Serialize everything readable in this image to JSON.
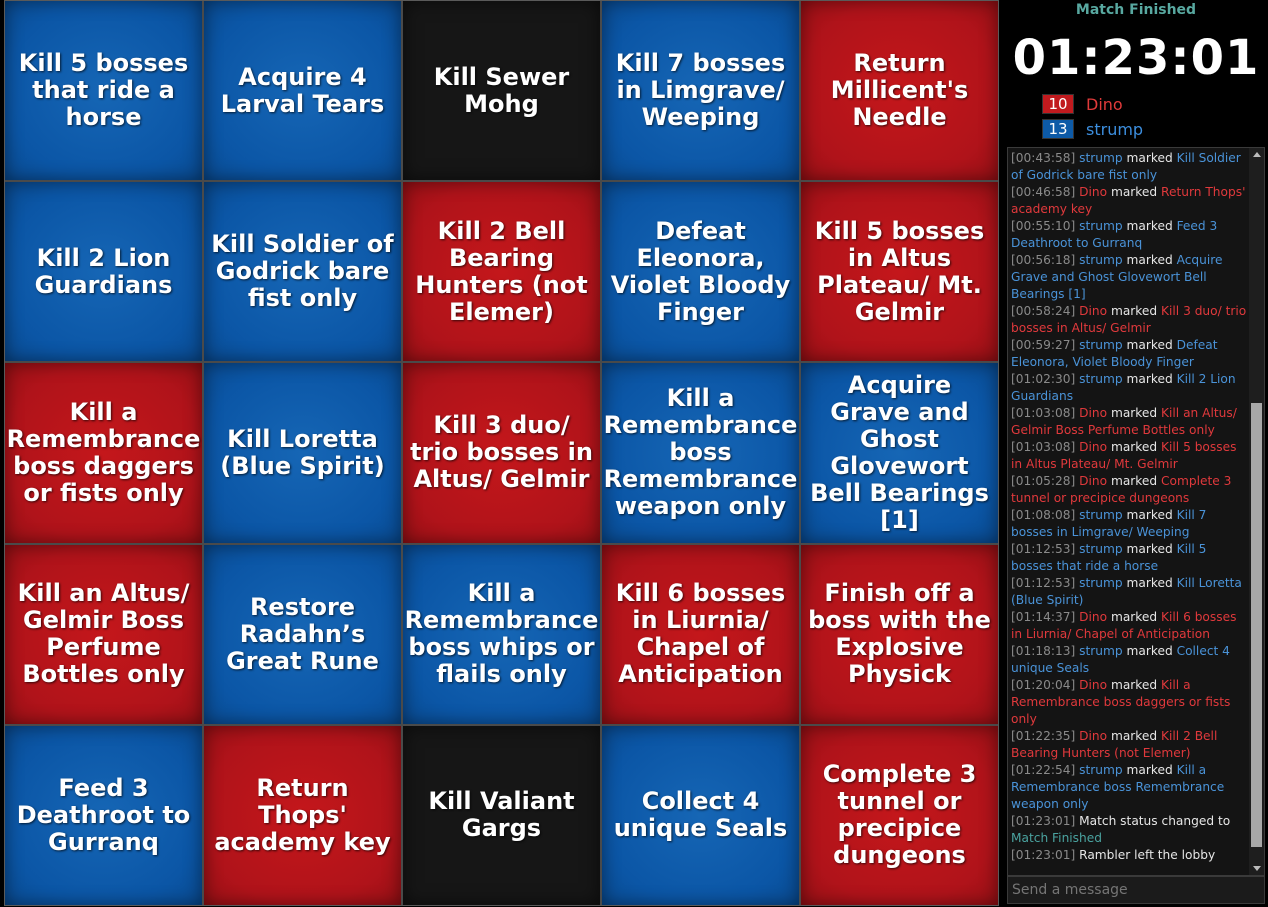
{
  "board": [
    {
      "text": "Kill 5 bosses that ride a horse",
      "color": "blue"
    },
    {
      "text": "Acquire 4 Larval Tears",
      "color": "blue"
    },
    {
      "text": "Kill Sewer Mohg",
      "color": "black"
    },
    {
      "text": "Kill 7 bosses in Limgrave/ Weeping",
      "color": "blue"
    },
    {
      "text": "Return Millicent's Needle",
      "color": "red"
    },
    {
      "text": "Kill 2 Lion Guardians",
      "color": "blue"
    },
    {
      "text": "Kill Soldier of Godrick bare fist only",
      "color": "blue"
    },
    {
      "text": "Kill 2 Bell Bearing Hunters (not Elemer)",
      "color": "red"
    },
    {
      "text": "Defeat Eleonora, Violet Bloody Finger",
      "color": "blue"
    },
    {
      "text": "Kill 5 bosses in Altus Plateau/ Mt. Gelmir",
      "color": "red"
    },
    {
      "text": "Kill a Remembrance boss daggers or fists only",
      "color": "red"
    },
    {
      "text": "Kill Loretta (Blue Spirit)",
      "color": "blue"
    },
    {
      "text": "Kill 3 duo/ trio bosses in Altus/ Gelmir",
      "color": "red"
    },
    {
      "text": "Kill a Remembrance boss Remembrance weapon only",
      "color": "blue"
    },
    {
      "text": "Acquire Grave and Ghost Glovewort Bell Bearings [1]",
      "color": "blue"
    },
    {
      "text": "Kill an Altus/ Gelmir Boss Perfume Bottles only",
      "color": "red"
    },
    {
      "text": "Restore Radahn’s Great Rune",
      "color": "blue"
    },
    {
      "text": "Kill a Remembrance boss whips or flails only",
      "color": "blue"
    },
    {
      "text": "Kill 6 bosses in Liurnia/ Chapel of Anticipation",
      "color": "red"
    },
    {
      "text": "Finish off a boss with the Explosive Physick",
      "color": "red"
    },
    {
      "text": "Feed 3 Deathroot to Gurranq",
      "color": "blue"
    },
    {
      "text": "Return Thops' academy key",
      "color": "red"
    },
    {
      "text": "Kill Valiant Gargs",
      "color": "black"
    },
    {
      "text": "Collect 4 unique Seals",
      "color": "blue"
    },
    {
      "text": "Complete 3 tunnel or precipice dungeons",
      "color": "red"
    }
  ],
  "match": {
    "status": "Match Finished",
    "timer": "01:23:01"
  },
  "players": [
    {
      "score": "10",
      "name": "Dino",
      "color": "#c11a1e"
    },
    {
      "score": "13",
      "name": "strump",
      "color": "#0d5aa7"
    }
  ],
  "log": [
    {
      "ts": "[00:43:58]",
      "name": "strump",
      "team": "blue",
      "verb": "marked",
      "goal": "Kill Soldier of Godrick bare fist only"
    },
    {
      "ts": "[00:46:58]",
      "name": "Dino",
      "team": "red",
      "verb": "marked",
      "goal": "Return Thops' academy key"
    },
    {
      "ts": "[00:55:10]",
      "name": "strump",
      "team": "blue",
      "verb": "marked",
      "goal": "Feed 3 Deathroot to Gurranq"
    },
    {
      "ts": "[00:56:18]",
      "name": "strump",
      "team": "blue",
      "verb": "marked",
      "goal": "Acquire Grave and Ghost Glovewort Bell Bearings [1]"
    },
    {
      "ts": "[00:58:24]",
      "name": "Dino",
      "team": "red",
      "verb": "marked",
      "goal": "Kill 3 duo/ trio bosses in Altus/ Gelmir"
    },
    {
      "ts": "[00:59:27]",
      "name": "strump",
      "team": "blue",
      "verb": "marked",
      "goal": "Defeat Eleonora, Violet Bloody Finger"
    },
    {
      "ts": "[01:02:30]",
      "name": "strump",
      "team": "blue",
      "verb": "marked",
      "goal": "Kill 2 Lion Guardians"
    },
    {
      "ts": "[01:03:08]",
      "name": "Dino",
      "team": "red",
      "verb": "marked",
      "goal": "Kill an Altus/ Gelmir Boss Perfume Bottles only"
    },
    {
      "ts": "[01:03:08]",
      "name": "Dino",
      "team": "red",
      "verb": "marked",
      "goal": "Kill 5 bosses in Altus Plateau/ Mt. Gelmir"
    },
    {
      "ts": "[01:05:28]",
      "name": "Dino",
      "team": "red",
      "verb": "marked",
      "goal": "Complete 3 tunnel or precipice dungeons"
    },
    {
      "ts": "[01:08:08]",
      "name": "strump",
      "team": "blue",
      "verb": "marked",
      "goal": "Kill 7 bosses in Limgrave/ Weeping"
    },
    {
      "ts": "[01:12:53]",
      "name": "strump",
      "team": "blue",
      "verb": "marked",
      "goal": "Kill 5 bosses that ride a horse"
    },
    {
      "ts": "[01:12:53]",
      "name": "strump",
      "team": "blue",
      "verb": "marked",
      "goal": "Kill Loretta (Blue Spirit)"
    },
    {
      "ts": "[01:14:37]",
      "name": "Dino",
      "team": "red",
      "verb": "marked",
      "goal": "Kill 6 bosses in Liurnia/ Chapel of Anticipation"
    },
    {
      "ts": "[01:18:13]",
      "name": "strump",
      "team": "blue",
      "verb": "marked",
      "goal": "Collect 4 unique Seals"
    },
    {
      "ts": "[01:20:04]",
      "name": "Dino",
      "team": "red",
      "verb": "marked",
      "goal": "Kill a Remembrance boss daggers or fists only"
    },
    {
      "ts": "[01:22:35]",
      "name": "Dino",
      "team": "red",
      "verb": "marked",
      "goal": "Kill 2 Bell Bearing Hunters (not Elemer)"
    },
    {
      "ts": "[01:22:54]",
      "name": "strump",
      "team": "blue",
      "verb": "marked",
      "goal": "Kill a Remembrance boss Remembrance weapon only"
    },
    {
      "ts": "[01:23:01]",
      "name": "",
      "team": "",
      "verb": "Match status changed to",
      "goal": "Match Finished",
      "goal_team": "status"
    },
    {
      "ts": "[01:23:01]",
      "name": "",
      "team": "",
      "verb": "Rambler left the lobby",
      "goal": ""
    }
  ],
  "message_input": {
    "placeholder": "Send a message"
  }
}
